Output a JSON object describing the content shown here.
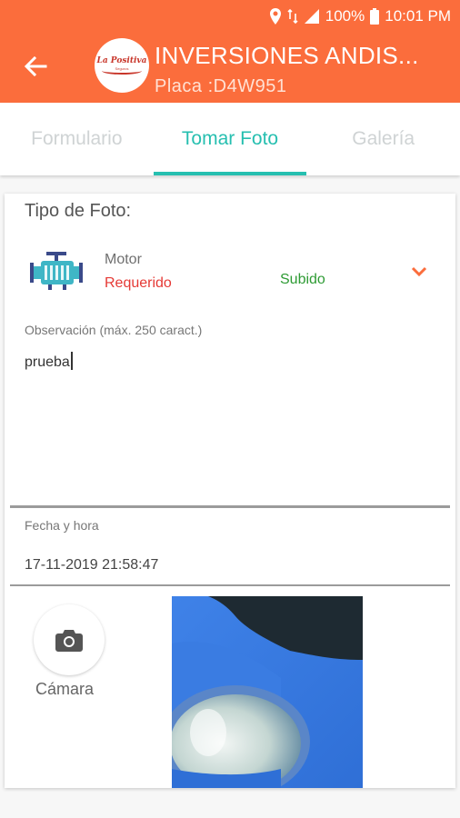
{
  "status_bar": {
    "battery": "100%",
    "time": "10:01 PM"
  },
  "header": {
    "title": "INVERSIONES ANDIS...",
    "subtitle": "Placa :D4W951",
    "logo_text": "La Positiva",
    "logo_sub": "Seguros",
    "color": "#fb6d3c"
  },
  "tabs": [
    {
      "label": "Formulario",
      "active": false
    },
    {
      "label": "Tomar Foto",
      "active": true
    },
    {
      "label": "Galería",
      "active": false
    }
  ],
  "form": {
    "section_label": "Tipo de Foto:",
    "photo_type": {
      "name": "Motor",
      "requirement": "Requerido",
      "status": "Subido",
      "icon": "engine-icon"
    },
    "observation": {
      "label": "Observación (máx. 250 caract.)",
      "value": "prueba"
    },
    "datetime": {
      "label": "Fecha y hora",
      "value": "17-11-2019 21:58:47"
    },
    "camera": {
      "label": "Cámara",
      "icon": "camera-icon"
    }
  },
  "colors": {
    "accent": "#26bfb0",
    "required": "#e53935",
    "uploaded": "#2e9b34"
  }
}
